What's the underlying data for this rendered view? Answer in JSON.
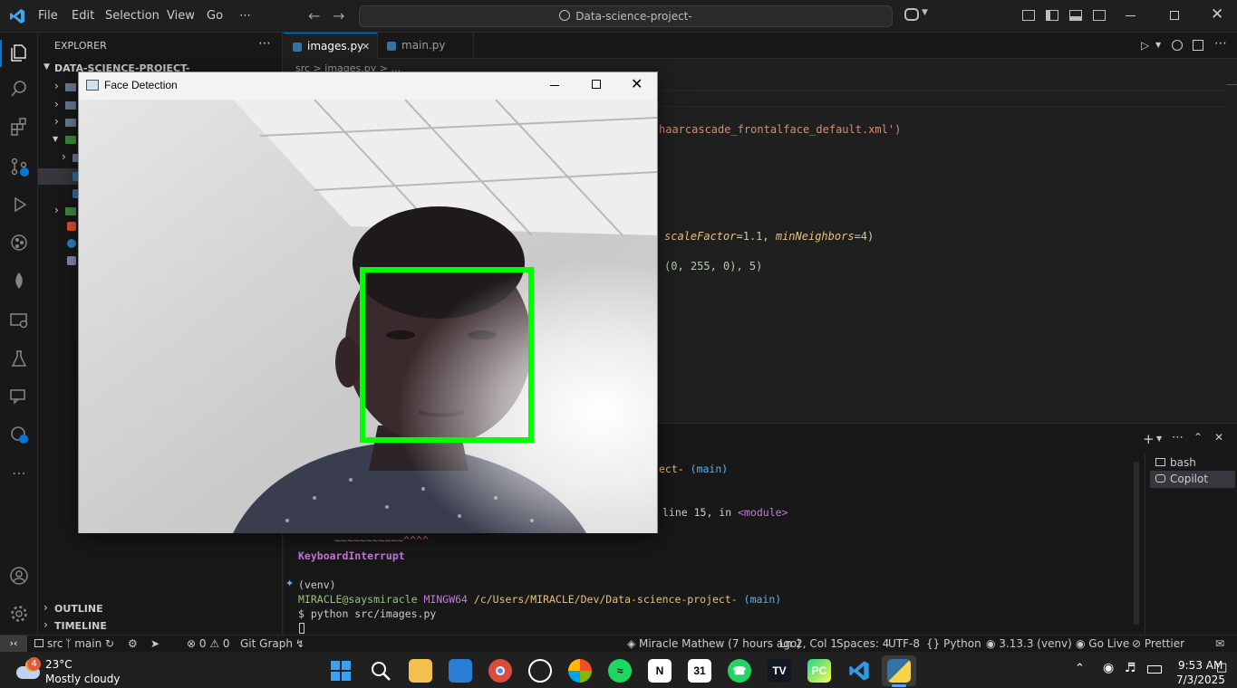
{
  "titlebar": {
    "menu": [
      "File",
      "Edit",
      "Selection",
      "View",
      "Go",
      "⋯"
    ],
    "search_text": "Data-science-project-"
  },
  "tabs": [
    {
      "label": "images.py",
      "active": true
    },
    {
      "label": "main.py",
      "active": false
    }
  ],
  "breadcrumb": "src > images.py > ...",
  "explorer": {
    "header": "EXPLORER",
    "root": "DATA-SCIENCE-PROJECT-",
    "outline": "OUTLINE",
    "timeline": "TIMELINE"
  },
  "code": {
    "line1": "haarcascade_frontalface_default.xml')",
    "line2_a": "scaleFactor",
    "line2_b": "=",
    "line2_c": "1.1",
    "line2_d": ", ",
    "line2_e": "minNeighbors",
    "line2_f": "=",
    "line2_g": "4",
    "line2_h": ")",
    "line3": "(0, 255, 0), 5)"
  },
  "terminal": {
    "frag1_a": "ect- ",
    "frag1_b": "(main)",
    "frag2_a": "line 15, in ",
    "frag2_b": "<module>",
    "squiggle": "~~~~~~~~~~~^^^^",
    "keyboard_interrupt": "KeyboardInterrupt",
    "venv": "(venv)",
    "prompt_user": "MIRACLE@saysmiracle",
    "prompt_sys": "MINGW64",
    "prompt_path": "/c/Users/MIRACLE/Dev/Data-science-project-",
    "prompt_branch": "(main)",
    "command": "$ python src/images.py",
    "shells": [
      "bash",
      "Copilot"
    ]
  },
  "facewin": {
    "title": "Face Detection"
  },
  "statusbar": {
    "src": "src",
    "branch": "main",
    "errors": "0",
    "warnings": "0",
    "git_graph": "Git Graph",
    "blame": "Miracle Mathew (7 hours ago)",
    "position": "Ln 2, Col 1",
    "spaces": "Spaces: 4",
    "encoding": "UTF-8",
    "language": "Python",
    "interpreter": "3.13.3 (venv)",
    "golive": "Go Live",
    "prettier": "Prettier"
  },
  "taskbar": {
    "temp": "23°C",
    "weather": "Mostly cloudy",
    "badge": "4",
    "time": "9:53 AM",
    "date": "7/3/2025",
    "calendar_day": "31"
  }
}
